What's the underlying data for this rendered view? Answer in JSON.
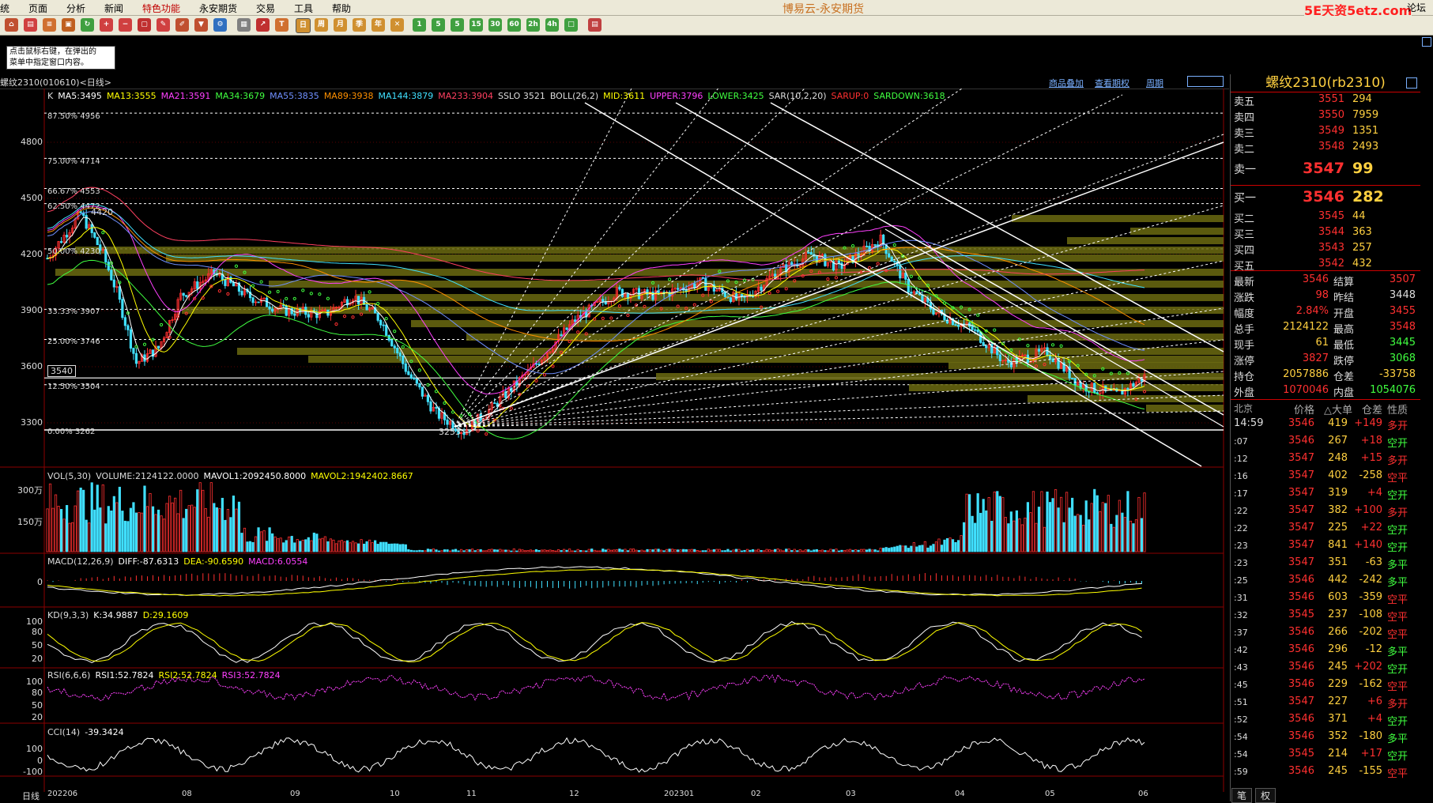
{
  "menu": [
    "统",
    "页面",
    "分析",
    "新闻",
    "特色功能",
    "交易",
    "工具",
    "帮助"
  ],
  "menu_extra": "永安期货",
  "app_title": "博易云-永安期货",
  "watermark": "5E天资5etz.com",
  "watermark_side": "论坛",
  "toolbar_labels": [
    "周",
    "月",
    "季",
    "年",
    "1",
    "5",
    "15",
    "30",
    "60",
    "2h",
    "4h"
  ],
  "hint_text": [
    "点击鼠标右键，在弹出的",
    "菜单中指定窗口内容。"
  ],
  "symbol_label": "螺纹2310(010610)<日线>",
  "title_links": [
    "商品叠加",
    "查看期权",
    "周期"
  ],
  "ma_indicators": [
    {
      "text": "K",
      "color": "#dddddd"
    },
    {
      "text": "MA5:3495",
      "color": "#ffffff"
    },
    {
      "text": "MA13:3555",
      "color": "#ffff00"
    },
    {
      "text": "MA21:3591",
      "color": "#ff40ff"
    },
    {
      "text": "MA34:3679",
      "color": "#40ff40"
    },
    {
      "text": "MA55:3835",
      "color": "#7090ff"
    },
    {
      "text": "MA89:3938",
      "color": "#ff9000"
    },
    {
      "text": "MA144:3879",
      "color": "#40e0ff"
    },
    {
      "text": "MA233:3904",
      "color": "#ff4060"
    },
    {
      "text": "SSLO 3521",
      "color": "#dddddd"
    },
    {
      "text": "BOLL(26,2)",
      "color": "#dddddd"
    },
    {
      "text": "MID:3611",
      "color": "#ffff00"
    },
    {
      "text": "UPPER:3796",
      "color": "#ff40ff"
    },
    {
      "text": "LOWER:3425",
      "color": "#40ff40"
    },
    {
      "text": "SAR(10,2,20)",
      "color": "#dddddd"
    },
    {
      "text": "SARUP:0",
      "color": "#ff3030"
    },
    {
      "text": "SARDOWN:3618",
      "color": "#40ff40"
    }
  ],
  "y_ticks": [
    "4800",
    "4500",
    "4200",
    "3900",
    "3600",
    "3300"
  ],
  "price_marker": "3540",
  "low_marker": "3253",
  "high_marker": "4420",
  "fib_levels": [
    {
      "label": "87.50%  4956",
      "price": 4956
    },
    {
      "label": "75.00%  4714",
      "price": 4714
    },
    {
      "label": "66.67%  4553",
      "price": 4553
    },
    {
      "label": "62.50%  4472",
      "price": 4472
    },
    {
      "label": "50.00%  4230",
      "price": 4230
    },
    {
      "label": "33.33%  3907",
      "price": 3907
    },
    {
      "label": "25.00%  3746",
      "price": 3746
    },
    {
      "label": "12.50%  3504",
      "price": 3504
    },
    {
      "label": "0.00%  3262",
      "price": 3262
    }
  ],
  "vol_indicator": [
    {
      "text": "VOL(5,30)",
      "color": "#dddddd"
    },
    {
      "text": "VOLUME:2124122.0000",
      "color": "#dddddd"
    },
    {
      "text": "MAVOL1:2092450.8000",
      "color": "#ffffff"
    },
    {
      "text": "MAVOL2:1942402.8667",
      "color": "#ffff00"
    }
  ],
  "vol_ticks": [
    "300万",
    "150万"
  ],
  "macd_indicator": [
    {
      "text": "MACD(12,26,9)",
      "color": "#dddddd"
    },
    {
      "text": "DIFF:-87.6313",
      "color": "#ffffff"
    },
    {
      "text": "DEA:-90.6590",
      "color": "#ffff00"
    },
    {
      "text": "MACD:6.0554",
      "color": "#ff40ff"
    }
  ],
  "macd_ticks": [
    "0"
  ],
  "kd_indicator": [
    {
      "text": "KD(9,3,3)",
      "color": "#dddddd"
    },
    {
      "text": "K:34.9887",
      "color": "#ffffff"
    },
    {
      "text": "D:29.1609",
      "color": "#ffff00"
    }
  ],
  "kd_ticks": [
    "100",
    "80",
    "50",
    "20"
  ],
  "rsi_indicator": [
    {
      "text": "RSI(6,6,6)",
      "color": "#dddddd"
    },
    {
      "text": "RSI1:52.7824",
      "color": "#ffffff"
    },
    {
      "text": "RSI2:52.7824",
      "color": "#ffff00"
    },
    {
      "text": "RSI3:52.7824",
      "color": "#ff40ff"
    }
  ],
  "rsi_ticks": [
    "100",
    "80",
    "50",
    "20"
  ],
  "cci_indicator": [
    {
      "text": "CCI(14)",
      "color": "#dddddd"
    },
    {
      "text": "-39.3424",
      "color": "#ffffff"
    }
  ],
  "cci_ticks": [
    "100",
    "0",
    "-100"
  ],
  "date_label": "日线",
  "x_ticks": [
    "202206",
    "08",
    "09",
    "10",
    "11",
    "12",
    "202301",
    "02",
    "03",
    "04",
    "05",
    "06"
  ],
  "quote": {
    "title": "螺纹2310(rb2310)",
    "asks": [
      {
        "label": "卖五",
        "price": "3551",
        "vol": "294"
      },
      {
        "label": "卖四",
        "price": "3550",
        "vol": "7959"
      },
      {
        "label": "卖三",
        "price": "3549",
        "vol": "1351"
      },
      {
        "label": "卖二",
        "price": "3548",
        "vol": "2493"
      },
      {
        "label": "卖一",
        "price": "3547",
        "vol": "99"
      }
    ],
    "bids": [
      {
        "label": "买一",
        "price": "3546",
        "vol": "282"
      },
      {
        "label": "买二",
        "price": "3545",
        "vol": "44"
      },
      {
        "label": "买三",
        "price": "3544",
        "vol": "363"
      },
      {
        "label": "买四",
        "price": "3543",
        "vol": "257"
      },
      {
        "label": "买五",
        "price": "3542",
        "vol": "432"
      }
    ],
    "stats": [
      {
        "l1": "最新",
        "v1": "3546",
        "c1": "#ff3030",
        "l2": "结算",
        "v2": "3507",
        "c2": "#ff3030"
      },
      {
        "l1": "涨跌",
        "v1": "98",
        "c1": "#ff3030",
        "l2": "昨结",
        "v2": "3448",
        "c2": "#dddddd"
      },
      {
        "l1": "幅度",
        "v1": "2.84%",
        "c1": "#ff3030",
        "l2": "开盘",
        "v2": "3455",
        "c2": "#ff3030"
      },
      {
        "l1": "总手",
        "v1": "2124122",
        "c1": "#ffd040",
        "l2": "最高",
        "v2": "3548",
        "c2": "#ff3030"
      },
      {
        "l1": "现手",
        "v1": "61",
        "c1": "#ffd040",
        "l2": "最低",
        "v2": "3445",
        "c2": "#40ff40"
      },
      {
        "l1": "涨停",
        "v1": "3827",
        "c1": "#ff3030",
        "l2": "跌停",
        "v2": "3068",
        "c2": "#40ff40"
      },
      {
        "l1": "持仓",
        "v1": "2057886",
        "c1": "#ffd040",
        "l2": "仓差",
        "v2": "-33758",
        "c2": "#ffd040"
      },
      {
        "l1": "外盘",
        "v1": "1070046",
        "c1": "#ff3030",
        "l2": "内盘",
        "v2": "1054076",
        "c2": "#40ff40"
      }
    ],
    "tick_header": {
      "t": "北京",
      "p": "价格",
      "v": "△大单",
      "c": "仓差",
      "n": "性质"
    },
    "ticks": [
      {
        "t": "14:59",
        "p": "3546",
        "v": "419",
        "c": "+149",
        "n": "多开"
      },
      {
        "t": ":07",
        "p": "3546",
        "v": "267",
        "c": "+18",
        "n": "空开"
      },
      {
        "t": ":12",
        "p": "3547",
        "v": "248",
        "c": "+15",
        "n": "多开"
      },
      {
        "t": ":16",
        "p": "3547",
        "v": "402",
        "c": "-258",
        "n": "空平"
      },
      {
        "t": ":17",
        "p": "3547",
        "v": "319",
        "c": "+4",
        "n": "空开"
      },
      {
        "t": ":22",
        "p": "3547",
        "v": "382",
        "c": "+100",
        "n": "多开"
      },
      {
        "t": ":22",
        "p": "3547",
        "v": "225",
        "c": "+22",
        "n": "空开"
      },
      {
        "t": ":23",
        "p": "3547",
        "v": "841",
        "c": "+140",
        "n": "空开"
      },
      {
        "t": ":23",
        "p": "3547",
        "v": "351",
        "c": "-63",
        "n": "多平"
      },
      {
        "t": ":25",
        "p": "3546",
        "v": "442",
        "c": "-242",
        "n": "多平"
      },
      {
        "t": ":31",
        "p": "3546",
        "v": "603",
        "c": "-359",
        "n": "空平"
      },
      {
        "t": ":32",
        "p": "3545",
        "v": "237",
        "c": "-108",
        "n": "空平"
      },
      {
        "t": ":37",
        "p": "3546",
        "v": "266",
        "c": "-202",
        "n": "空平"
      },
      {
        "t": ":42",
        "p": "3546",
        "v": "296",
        "c": "-12",
        "n": "多平"
      },
      {
        "t": ":43",
        "p": "3546",
        "v": "245",
        "c": "+202",
        "n": "空开"
      },
      {
        "t": ":45",
        "p": "3546",
        "v": "229",
        "c": "-162",
        "n": "空平"
      },
      {
        "t": ":51",
        "p": "3547",
        "v": "227",
        "c": "+6",
        "n": "多开"
      },
      {
        "t": ":52",
        "p": "3546",
        "v": "371",
        "c": "+4",
        "n": "空开"
      },
      {
        "t": ":54",
        "p": "3546",
        "v": "352",
        "c": "-180",
        "n": "多平"
      },
      {
        "t": ":54",
        "p": "3545",
        "v": "214",
        "c": "+17",
        "n": "空开"
      },
      {
        "t": ":59",
        "p": "3546",
        "v": "245",
        "c": "-155",
        "n": "空平"
      }
    ]
  },
  "bottom_tabs": [
    "笔",
    "权"
  ],
  "colors": {
    "up": "#ff3030",
    "down": "#40e0ff",
    "bg": "#000000",
    "grid": "#8b0000"
  }
}
